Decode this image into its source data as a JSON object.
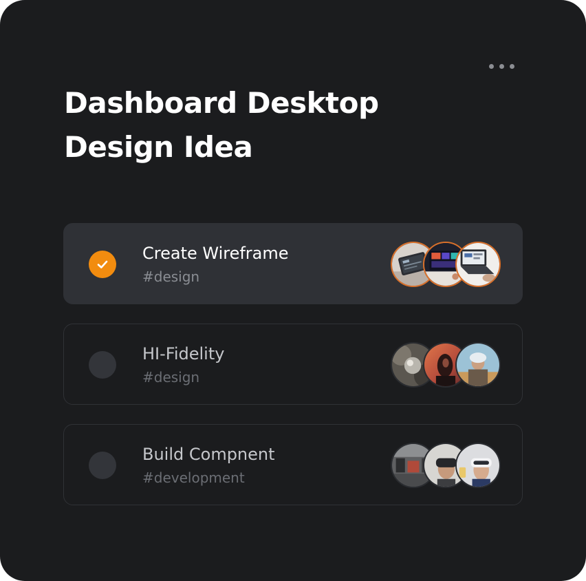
{
  "card": {
    "title": "Dashboard Desktop Design Idea",
    "more_icon": "more-horizontal-icon"
  },
  "tasks": [
    {
      "name": "Create Wireframe",
      "tag": "#design",
      "completed": true,
      "avatars": [
        "tablet-dashboard-photo",
        "monitor-charts-photo",
        "laptop-desk-photo"
      ]
    },
    {
      "name": "HI-Fidelity",
      "tag": "#design",
      "completed": false,
      "avatars": [
        "crystal-ball-photo",
        "sunset-portrait-photo",
        "field-portrait-photo"
      ]
    },
    {
      "name": "Build Compnent",
      "tag": "#development",
      "completed": false,
      "avatars": [
        "workshop-photo",
        "vr-headset-man-photo",
        "vr-headset-woman-photo"
      ]
    }
  ],
  "colors": {
    "card_background": "#1b1c1e",
    "active_row": "#2f3136",
    "accent_orange": "#f28c0f",
    "avatar_ring_active": "#d9702a"
  }
}
